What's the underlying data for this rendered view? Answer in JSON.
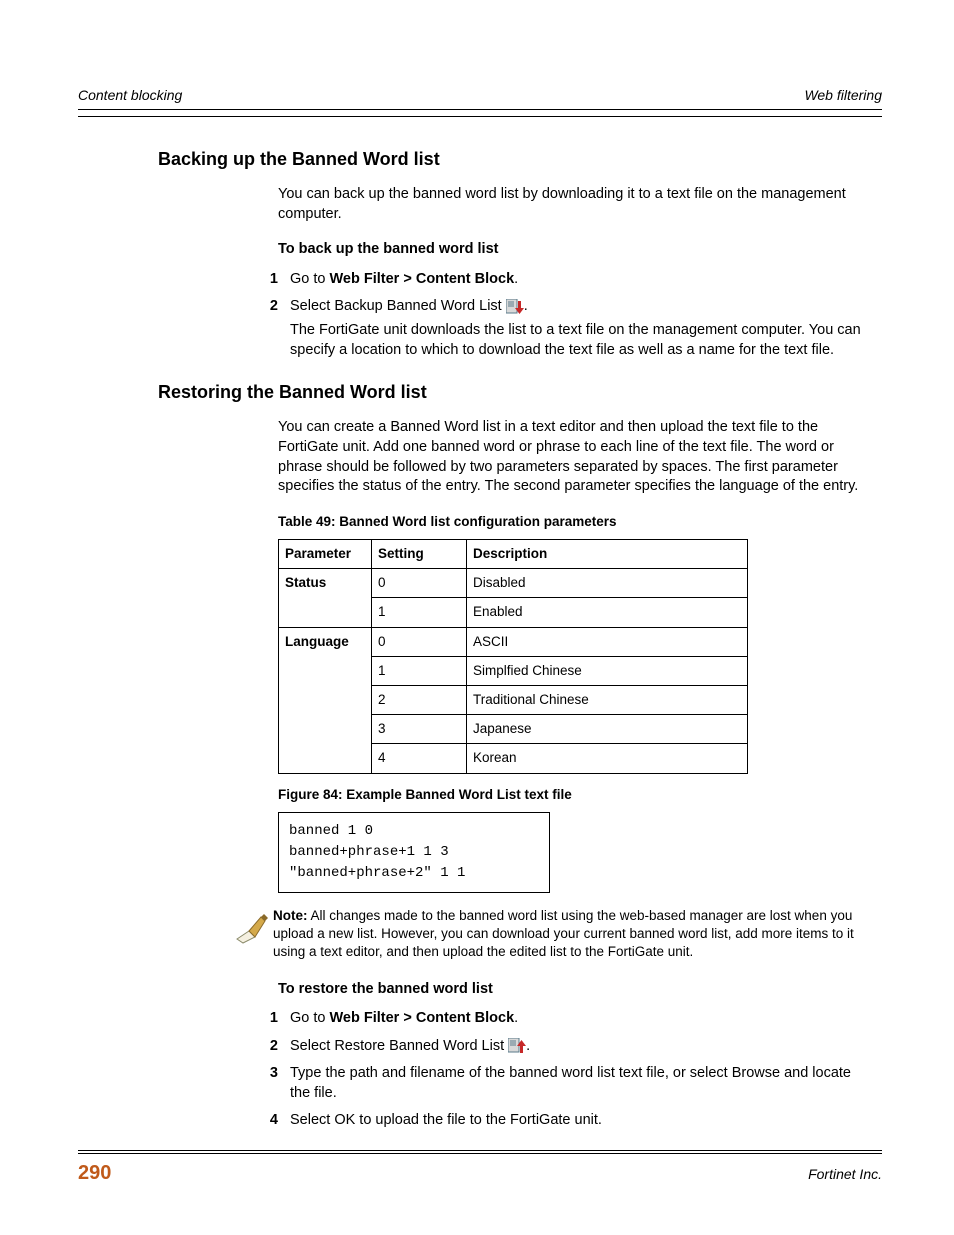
{
  "runningHeader": {
    "left": "Content blocking",
    "right": "Web filtering"
  },
  "section1": {
    "heading": "Backing up the Banned Word list",
    "intro": "You can back up the banned word list by downloading it to a text file on the management computer.",
    "procHeading": "To back up the banned word list",
    "steps": [
      {
        "num": "1",
        "pre": "Go to ",
        "bold": "Web Filter > Content Block",
        "post": "."
      },
      {
        "num": "2",
        "lead": "Select Backup Banned Word List ",
        "trail": ".",
        "body": "The FortiGate unit downloads the list to a text file on the management computer. You can specify a location to which to download the text file as well as a name for the text file."
      }
    ]
  },
  "section2": {
    "heading": "Restoring the Banned Word list",
    "intro": "You can create a Banned Word list in a text editor and then upload the text file to the FortiGate unit. Add one banned word or phrase to each line of the text file. The word or phrase should be followed by two parameters separated by spaces. The first parameter specifies the status of the entry. The second parameter specifies the language of the entry.",
    "tableCaption": "Table 49: Banned Word list configuration parameters",
    "tableHeaders": {
      "c1": "Parameter",
      "c2": "Setting",
      "c3": "Description"
    },
    "tableRows": [
      {
        "param": "Status",
        "setting": "0",
        "desc": "Disabled"
      },
      {
        "param": "",
        "setting": "1",
        "desc": "Enabled"
      },
      {
        "param": "Language",
        "setting": "0",
        "desc": "ASCII"
      },
      {
        "param": "",
        "setting": "1",
        "desc": "Simplfied Chinese"
      },
      {
        "param": "",
        "setting": "2",
        "desc": "Traditional Chinese"
      },
      {
        "param": "",
        "setting": "3",
        "desc": "Japanese"
      },
      {
        "param": "",
        "setting": "4",
        "desc": "Korean"
      }
    ],
    "figureCaption": "Figure 84: Example Banned Word List text file",
    "codeLines": [
      "banned 1 0",
      "banned+phrase+1 1 3",
      "\"banned+phrase+2\" 1 1"
    ],
    "noteLabel": "Note:",
    "noteText": " All changes made to the banned word list using the web-based manager are lost when you upload a new list. However, you can download your current banned word list, add more items to it using a text editor, and then upload the edited list to the FortiGate unit.",
    "procHeading": "To restore the banned word list",
    "steps": [
      {
        "num": "1",
        "pre": "Go to ",
        "bold": "Web Filter > Content Block",
        "post": "."
      },
      {
        "num": "2",
        "lead": "Select Restore Banned Word List ",
        "trail": "."
      },
      {
        "num": "3",
        "body": "Type the path and filename of the banned word list text file, or select Browse and locate the file."
      },
      {
        "num": "4",
        "body": "Select OK to upload the file to the FortiGate unit."
      }
    ]
  },
  "footer": {
    "pageNum": "290",
    "company": "Fortinet Inc."
  }
}
